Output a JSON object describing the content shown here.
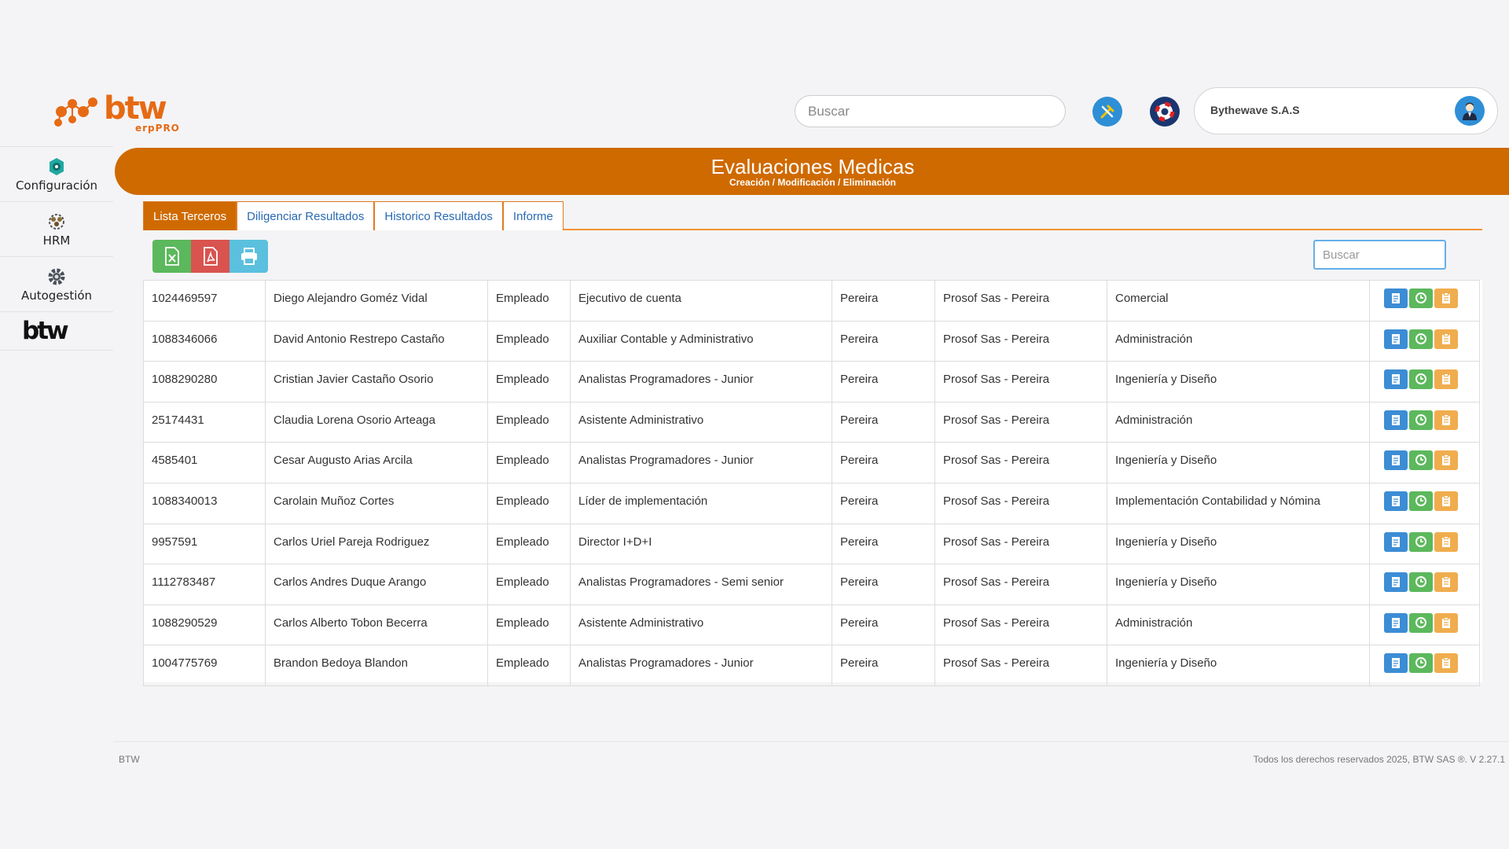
{
  "header": {
    "brand_text": "btw",
    "brand_sub": "erpPRO",
    "search_placeholder": "Buscar",
    "company_name": "Bythewave S.A.S",
    "tools_icon": "tools-icon",
    "help_icon": "lifebuoy-icon",
    "avatar_icon": "user-avatar-icon"
  },
  "sidebar": {
    "items": [
      {
        "label": "Configuración",
        "icon": "gear-icon"
      },
      {
        "label": "HRM",
        "icon": "people-icon"
      },
      {
        "label": "Autogestión",
        "icon": "cog-icon"
      }
    ],
    "brand": "btw"
  },
  "page": {
    "title": "Evaluaciones Medicas",
    "subtitle": "Creación / Modificación / Eliminación"
  },
  "tabs": [
    {
      "label": "Lista Terceros",
      "active": true
    },
    {
      "label": "Diligenciar Resultados",
      "active": false
    },
    {
      "label": "Historico Resultados",
      "active": false
    },
    {
      "label": "Informe",
      "active": false
    }
  ],
  "toolbar": {
    "export_excel_icon": "excel-icon",
    "export_pdf_icon": "pdf-icon",
    "print_icon": "print-icon",
    "search_placeholder": "Buscar"
  },
  "colors": {
    "accent": "#cf6a00",
    "link": "#2a6ab3",
    "btn_blue": "#3c8dd5",
    "btn_green": "#5cb85c",
    "btn_orange": "#f0ad4e"
  },
  "table": {
    "rows": [
      [
        "1024469597",
        "Diego Alejandro Goméz Vidal",
        "Empleado",
        "Ejecutivo de cuenta",
        "Pereira",
        "Prosof Sas - Pereira",
        "Comercial"
      ],
      [
        "1088346066",
        "David Antonio Restrepo Castaño",
        "Empleado",
        "Auxiliar Contable y Administrativo",
        "Pereira",
        "Prosof Sas - Pereira",
        "Administración"
      ],
      [
        "1088290280",
        "Cristian Javier Castaño Osorio",
        "Empleado",
        "Analistas Programadores - Junior",
        "Pereira",
        "Prosof Sas - Pereira",
        "Ingeniería y Diseño"
      ],
      [
        "25174431",
        "Claudia Lorena Osorio Arteaga",
        "Empleado",
        "Asistente Administrativo",
        "Pereira",
        "Prosof Sas - Pereira",
        "Administración"
      ],
      [
        "4585401",
        "Cesar Augusto Arias Arcila",
        "Empleado",
        "Analistas Programadores - Junior",
        "Pereira",
        "Prosof Sas - Pereira",
        "Ingeniería y Diseño"
      ],
      [
        "1088340013",
        "Carolain Muñoz Cortes",
        "Empleado",
        "Líder de implementación",
        "Pereira",
        "Prosof Sas - Pereira",
        "Implementación Contabilidad y Nómina"
      ],
      [
        "9957591",
        "Carlos Uriel Pareja Rodriguez",
        "Empleado",
        "Director I+D+I",
        "Pereira",
        "Prosof Sas - Pereira",
        "Ingeniería y Diseño"
      ],
      [
        "1112783487",
        "Carlos Andres Duque Arango",
        "Empleado",
        "Analistas Programadores - Semi senior",
        "Pereira",
        "Prosof Sas - Pereira",
        "Ingeniería y Diseño"
      ],
      [
        "1088290529",
        "Carlos Alberto Tobon Becerra",
        "Empleado",
        "Asistente Administrativo",
        "Pereira",
        "Prosof Sas - Pereira",
        "Administración"
      ],
      [
        "1004775769",
        "Brandon Bedoya Blandon",
        "Empleado",
        "Analistas Programadores - Junior",
        "Pereira",
        "Prosof Sas - Pereira",
        "Ingeniería y Diseño"
      ]
    ],
    "row_actions": [
      "edit-document-icon",
      "history-clock-icon",
      "clipboard-icon"
    ]
  },
  "footer": {
    "left": "BTW",
    "right": "Todos los derechos reservados 2025, BTW SAS ®. V 2.27.1"
  }
}
